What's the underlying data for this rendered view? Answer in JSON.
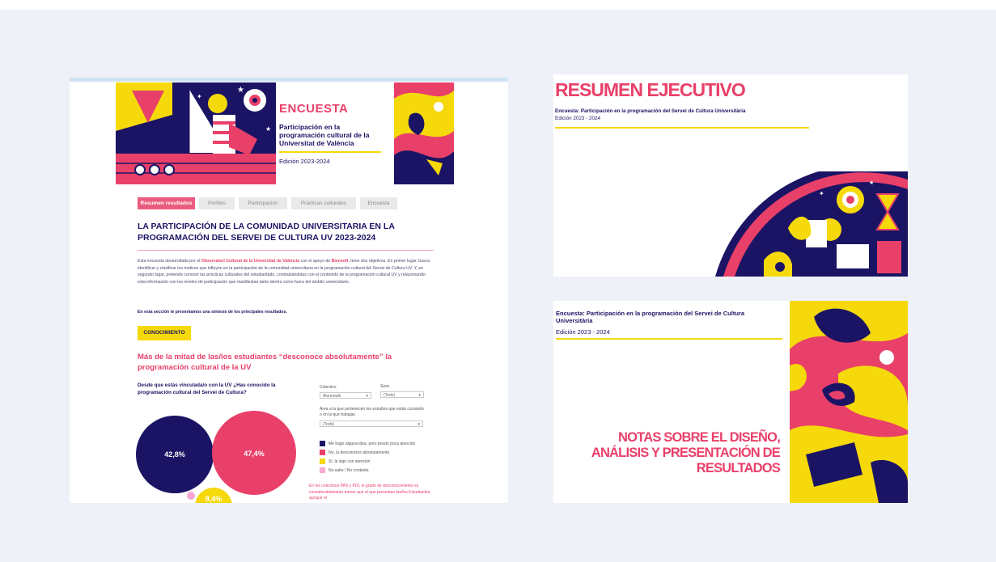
{
  "colors": {
    "pink": "#e9406a",
    "navy": "#1b1464",
    "yellow": "#f5d90a",
    "background": "#eef1f8"
  },
  "dashboard": {
    "hero": {
      "title": "ENCUESTA",
      "subtitle": "Participación en la programación cultural de la Universitat de València",
      "edition": "Edición 2023-2024"
    },
    "tabs": [
      "Resumen resultados",
      "Perfiles",
      "Participación",
      "Prácticas culturales",
      "Encuesta"
    ],
    "active_tab": "Resumen resultados",
    "main_title": "LA PARTICIPACIÓN DE LA COMUNIDAD UNIVERSITARIA EN LA PROGRAMACIÓN DEL SERVEI DE CULTURA UV 2023-2024",
    "intro": {
      "part1": "Esta encuesta desarrollada por el ",
      "org1": "Observatori Cultural de la Universitat de València",
      "part2": " con el apoyo de ",
      "org2": "Biensoft",
      "part3": ", tiene dos objetivos. En primer lugar, busca identificar y clasificar los motivos que influyen en la participación de la comunidad universitaria en la programación cultural del Servei de Cultura UV. Y, en segundo lugar, pretende conocer las prácticas culturales del estudiantado, contrastándolas con el contenido de la programación cultural UV y relacionando esta información con los niveles de participación que manifiestan tanto dentro como fuera del ámbito universitario."
    },
    "summary_note": "En esta sección te presentamos una síntesis de los principales resultados.",
    "section_badge": "CONOCIMIENTO",
    "headline": "Más de la mitad de las/los estudiantes “desconoce absolutamente” la programación cultural de la UV",
    "question": "Desde que estás vinculada/o con la UV ¿Has conocido la programación cultural del Servei de Cultura?",
    "filters": {
      "collective_label": "Colectivo",
      "collective_value": "Alumnado",
      "sex_label": "Sexo",
      "sex_value": "(Todo)",
      "area_label": "Área a la que pertenecen los estudios que estás cursando o en la que trabajas",
      "area_value": "(Todo)"
    },
    "legend": [
      {
        "label": "Me hago alguna idea, pero presto poca atención",
        "color": "#1b1464"
      },
      {
        "label": "No, la desconozco absolutamente",
        "color": "#e9406a"
      },
      {
        "label": "Sí, la sigo con atención",
        "color": "#f5d90a"
      },
      {
        "label": "No sabe / No contesta",
        "color": "#f6a8d2"
      }
    ],
    "bubbles": [
      {
        "label": "42,8%",
        "value": 42.8,
        "color": "#1b1464"
      },
      {
        "label": "47,4%",
        "value": 47.4,
        "color": "#e9406a"
      },
      {
        "label": "8,4%",
        "value": 8.4,
        "color": "#f5d90a"
      },
      {
        "label": "",
        "value": 1.4,
        "color": "#f6a8d2"
      }
    ],
    "footnote": "En los colectivos PAS y PDI, el grado de desconocimiento es considerablemente menor que el que presentan las/los Estudiantes, aunque el"
  },
  "slide1": {
    "title": "RESUMEN EJECUTIVO",
    "subtitle": "Encuesta: Participación en la programación del Servei de Cultura Universitària",
    "edition": "Edición 2023 - 2024"
  },
  "slide2": {
    "subtitle": "Encuesta: Participación en la programación del Servei de Cultura Universitària",
    "edition": "Edición 2023 - 2024",
    "title": "NOTAS SOBRE EL DISEÑO, ANÁLISIS Y PRESENTACIÓN DE RESULTADOS"
  }
}
